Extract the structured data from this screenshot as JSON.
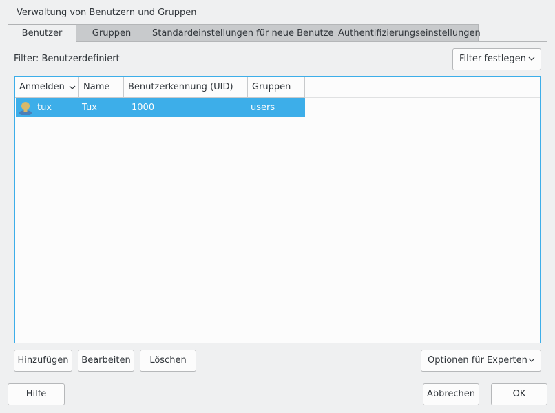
{
  "window": {
    "title": "Verwaltung von Benutzern und Gruppen"
  },
  "tabs": [
    {
      "label": "Benutzer",
      "active": true
    },
    {
      "label": "Gruppen",
      "active": false
    },
    {
      "label": "Standardeinstellungen für neue Benutzer",
      "active": false
    },
    {
      "label": "Authentifizierungseinstellungen",
      "active": false
    }
  ],
  "filter": {
    "label": "Filter: Benutzerdefiniert",
    "button": "Filter festlegen"
  },
  "table": {
    "columns": [
      "Anmelden",
      "Name",
      "Benutzerkennung (UID)",
      "Gruppen"
    ],
    "rows": [
      {
        "login": "tux",
        "name": "Tux",
        "uid": "1000",
        "groups": "users",
        "icon": "user-icon",
        "selected": true
      }
    ]
  },
  "actions": {
    "add": "Hinzufügen",
    "edit": "Bearbeiten",
    "delete": "Löschen",
    "expert": "Optionen für Experten"
  },
  "footer": {
    "help": "Hilfe",
    "cancel": "Abbrechen",
    "ok": "OK"
  },
  "colors": {
    "accent": "#3daee9",
    "background": "#eff0f1"
  }
}
